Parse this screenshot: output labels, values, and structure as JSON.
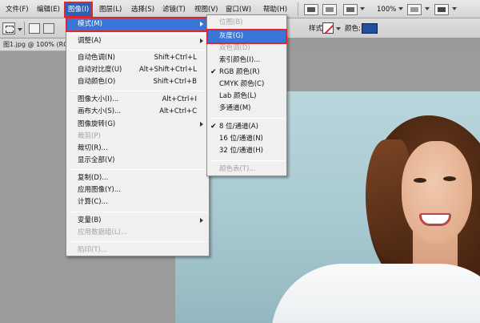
{
  "menubar": {
    "items": [
      {
        "label": "文件(F)"
      },
      {
        "label": "编辑(E)"
      },
      {
        "label": "图像(I)"
      },
      {
        "label": "图层(L)"
      },
      {
        "label": "选择(S)"
      },
      {
        "label": "滤镜(T)"
      },
      {
        "label": "视图(V)"
      },
      {
        "label": "窗口(W)"
      },
      {
        "label": "帮助(H)"
      }
    ],
    "active_item": "图像(I)",
    "zoom": "100%"
  },
  "options_bar": {
    "style_label": "样式:",
    "color_label": "颜色:",
    "swatch_color": "#1f4fa0"
  },
  "document_tab": {
    "title": "图1.jpg @ 100% (RG"
  },
  "image_menu": {
    "items": [
      {
        "label": "模式(M)",
        "shortcut": "",
        "submenu": true,
        "highlighted": true
      },
      {
        "label": "调整(A)",
        "shortcut": "",
        "submenu": true
      },
      {
        "label": "自动色调(N)",
        "shortcut": "Shift+Ctrl+L"
      },
      {
        "label": "自动对比度(U)",
        "shortcut": "Alt+Shift+Ctrl+L"
      },
      {
        "label": "自动颜色(O)",
        "shortcut": "Shift+Ctrl+B"
      },
      {
        "label": "图像大小(I)...",
        "shortcut": "Alt+Ctrl+I"
      },
      {
        "label": "画布大小(S)...",
        "shortcut": "Alt+Ctrl+C"
      },
      {
        "label": "图像旋转(G)",
        "shortcut": "",
        "submenu": true
      },
      {
        "label": "裁剪(P)",
        "shortcut": "",
        "disabled": true
      },
      {
        "label": "裁切(R)...",
        "shortcut": ""
      },
      {
        "label": "显示全部(V)",
        "shortcut": ""
      },
      {
        "label": "复制(D)...",
        "shortcut": ""
      },
      {
        "label": "应用图像(Y)...",
        "shortcut": ""
      },
      {
        "label": "计算(C)...",
        "shortcut": ""
      },
      {
        "label": "变量(B)",
        "shortcut": "",
        "submenu": true
      },
      {
        "label": "应用数据组(L)...",
        "shortcut": "",
        "disabled": true
      },
      {
        "label": "陷印(T)...",
        "shortcut": "",
        "disabled": true
      }
    ]
  },
  "mode_submenu": {
    "items": [
      {
        "label": "位图(B)",
        "disabled": true
      },
      {
        "label": "灰度(G)",
        "highlighted": true
      },
      {
        "label": "双色调(D)",
        "disabled": true
      },
      {
        "label": "索引颜色(I)..."
      },
      {
        "label": "RGB 颜色(R)",
        "checked": true
      },
      {
        "label": "CMYK 颜色(C)"
      },
      {
        "label": "Lab 颜色(L)"
      },
      {
        "label": "多通道(M)"
      },
      {
        "label": "8 位/通道(A)",
        "checked": true
      },
      {
        "label": "16 位/通道(N)"
      },
      {
        "label": "32 位/通道(H)"
      },
      {
        "label": "颜色表(T)...",
        "disabled": true
      }
    ],
    "check_mark": "✔"
  },
  "colors": {
    "highlight": "#3875d7",
    "annotation_red": "#e0262a"
  }
}
